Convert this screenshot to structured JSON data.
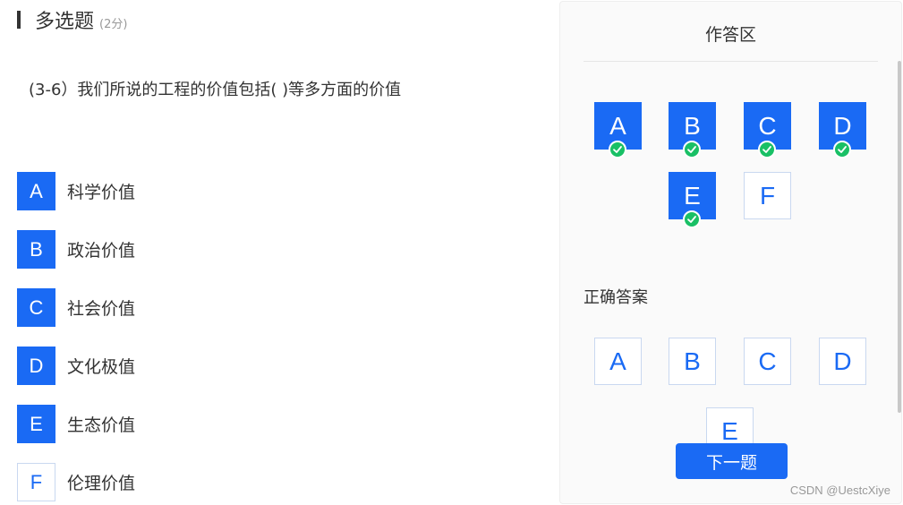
{
  "question": {
    "type": "多选题",
    "score": "(2分)",
    "text": "(3-6）我们所说的工程的价值包括(   )等多方面的价值"
  },
  "options": [
    {
      "letter": "A",
      "label": "科学价值",
      "selected": true
    },
    {
      "letter": "B",
      "label": "政治价值",
      "selected": true
    },
    {
      "letter": "C",
      "label": "社会价值",
      "selected": true
    },
    {
      "letter": "D",
      "label": "文化极值",
      "selected": true
    },
    {
      "letter": "E",
      "label": "生态价值",
      "selected": true
    },
    {
      "letter": "F",
      "label": "伦理价值",
      "selected": false
    }
  ],
  "panel": {
    "title": "作答区",
    "answer_sheet": [
      {
        "letter": "A",
        "selected": true,
        "checked": true
      },
      {
        "letter": "B",
        "selected": true,
        "checked": true
      },
      {
        "letter": "C",
        "selected": true,
        "checked": true
      },
      {
        "letter": "D",
        "selected": true,
        "checked": true
      },
      {
        "letter": "E",
        "selected": true,
        "checked": true
      },
      {
        "letter": "F",
        "selected": false,
        "checked": false
      }
    ],
    "correct_title": "正确答案",
    "correct_answers": [
      "A",
      "B",
      "C",
      "D",
      "E"
    ],
    "next_label": "下一题"
  },
  "watermark": "CSDN @UestcXiye",
  "colors": {
    "accent": "#1a6af4",
    "check": "#19c065"
  }
}
